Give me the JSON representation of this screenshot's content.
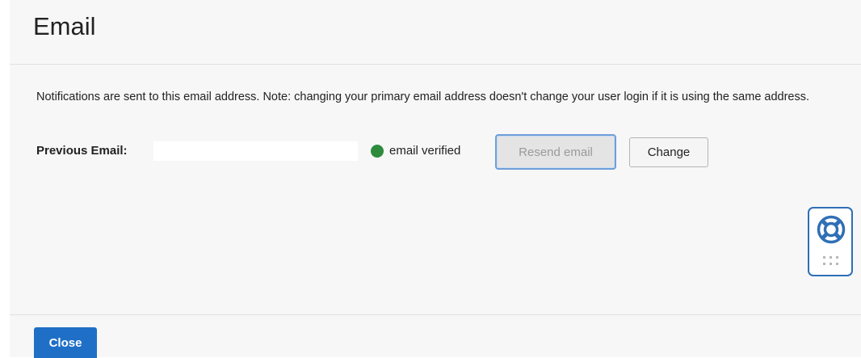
{
  "dialog": {
    "title": "Email",
    "description": "Notifications are sent to this email address. Note: changing your primary email address doesn't change your user login if it is using the same address.",
    "email_row": {
      "label": "Previous Email:",
      "value": "",
      "status_text": "email verified",
      "status_color": "#2e8b3d"
    },
    "buttons": {
      "resend_label": "Resend email",
      "change_label": "Change",
      "close_label": "Close"
    }
  },
  "help_widget": {
    "icon": "lifebuoy-icon",
    "handle_icon": "grip-dots-icon",
    "accent_color": "#2f6fb6"
  },
  "colors": {
    "primary_button": "#1f6fc6",
    "background": "#f7f7f7"
  }
}
